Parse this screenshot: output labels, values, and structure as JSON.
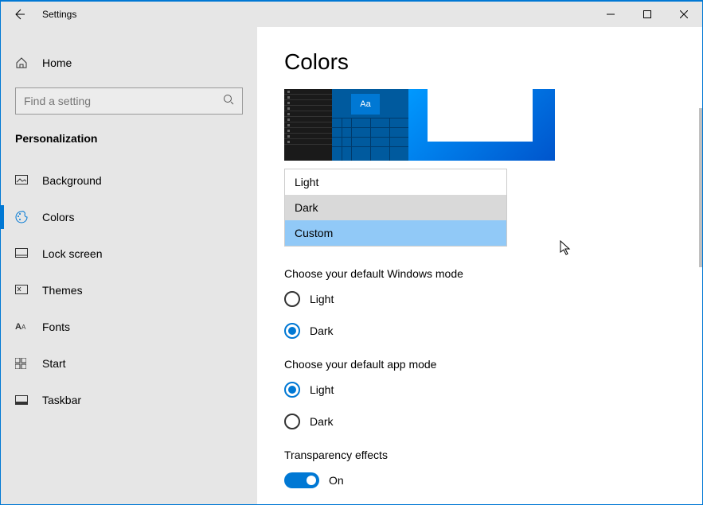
{
  "titlebar": {
    "title": "Settings"
  },
  "sidebar": {
    "home": "Home",
    "search_placeholder": "Find a setting",
    "section": "Personalization",
    "items": [
      {
        "label": "Background"
      },
      {
        "label": "Colors"
      },
      {
        "label": "Lock screen"
      },
      {
        "label": "Themes"
      },
      {
        "label": "Fonts"
      },
      {
        "label": "Start"
      },
      {
        "label": "Taskbar"
      }
    ]
  },
  "page": {
    "heading": "Colors",
    "preview_sample": "Aa",
    "color_mode_options": {
      "light": "Light",
      "dark": "Dark",
      "custom": "Custom"
    },
    "windows_mode": {
      "label": "Choose your default Windows mode",
      "light": "Light",
      "dark": "Dark",
      "selected": "Dark"
    },
    "app_mode": {
      "label": "Choose your default app mode",
      "light": "Light",
      "dark": "Dark",
      "selected": "Light"
    },
    "transparency": {
      "label": "Transparency effects",
      "state": "On"
    }
  }
}
